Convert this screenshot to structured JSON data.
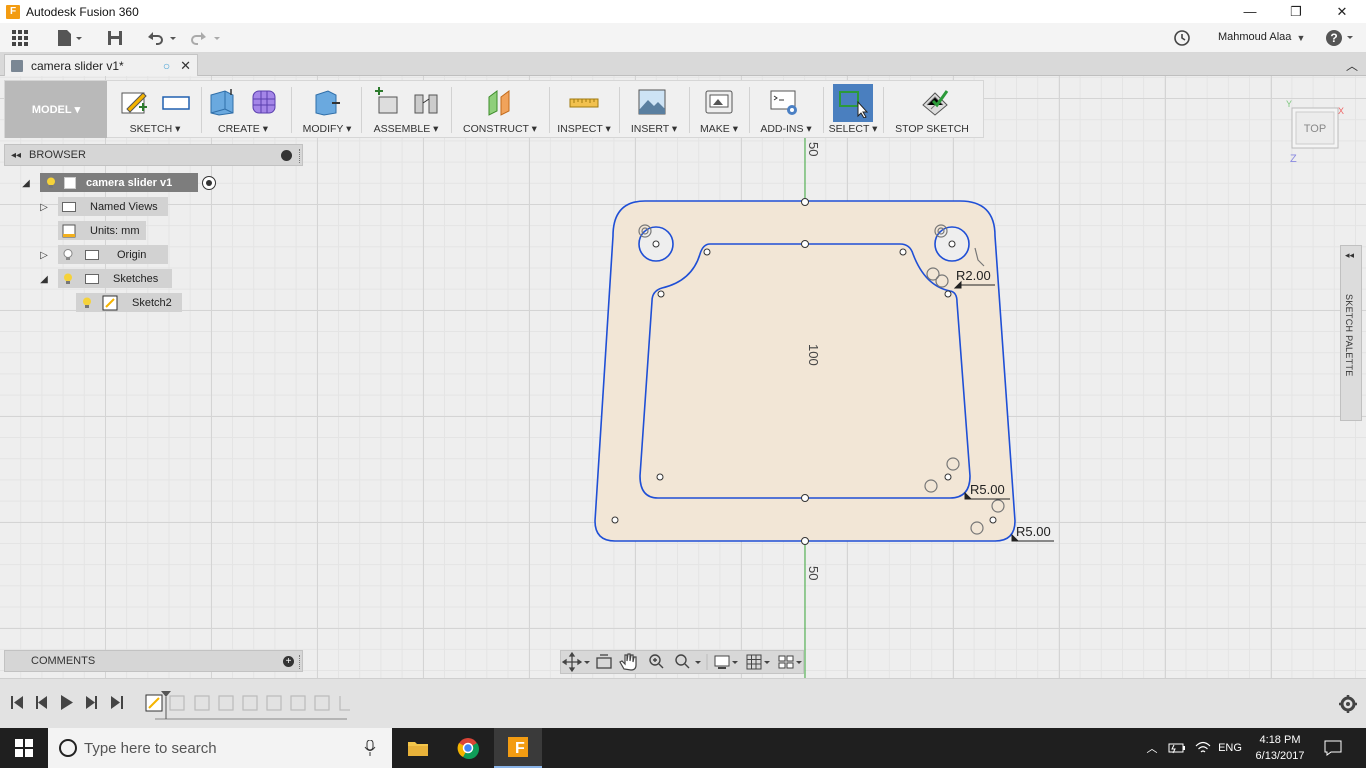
{
  "window": {
    "title": "Autodesk Fusion 360",
    "app_logo_letter": "F",
    "controls": [
      "—",
      "❐",
      "✕"
    ]
  },
  "quick_access": {
    "user_name": "Mahmoud Alaa",
    "help": "?"
  },
  "document_tab": {
    "name": "camera slider v1*"
  },
  "mode": {
    "label": "MODEL"
  },
  "ribbon": {
    "groups": [
      {
        "label": "SKETCH ▾"
      },
      {
        "label": "CREATE ▾"
      },
      {
        "label": "MODIFY ▾"
      },
      {
        "label": "ASSEMBLE ▾"
      },
      {
        "label": "CONSTRUCT ▾"
      },
      {
        "label": "INSPECT ▾"
      },
      {
        "label": "INSERT ▾"
      },
      {
        "label": "MAKE ▾"
      },
      {
        "label": "ADD-INS ▾"
      },
      {
        "label": "SELECT ▾"
      },
      {
        "label": "STOP SKETCH"
      }
    ]
  },
  "browser": {
    "title": "BROWSER",
    "root": "camera slider v1",
    "items": [
      "Named Views",
      "Units: mm",
      "Origin",
      "Sketches",
      "Sketch2"
    ]
  },
  "sketch": {
    "dimensions": {
      "top": "50",
      "height": "100",
      "bottom": "50"
    },
    "radii": [
      "R2.00",
      "R5.00",
      "R5.00"
    ],
    "colors": {
      "profile_line": "#1f4fd6",
      "profile_fill": "#f2e6d6",
      "axis": "#4caf50"
    }
  },
  "viewcube": {
    "face": "TOP",
    "y_axis": "Y",
    "x_axis": "X",
    "z_axis": "Z"
  },
  "comments": {
    "title": "COMMENTS"
  },
  "sketch_palette": {
    "label": "SKETCH PALETTE"
  },
  "taskbar": {
    "search_placeholder": "Type here to search",
    "language": "ENG",
    "time": "4:18 PM",
    "date": "6/13/2017"
  }
}
